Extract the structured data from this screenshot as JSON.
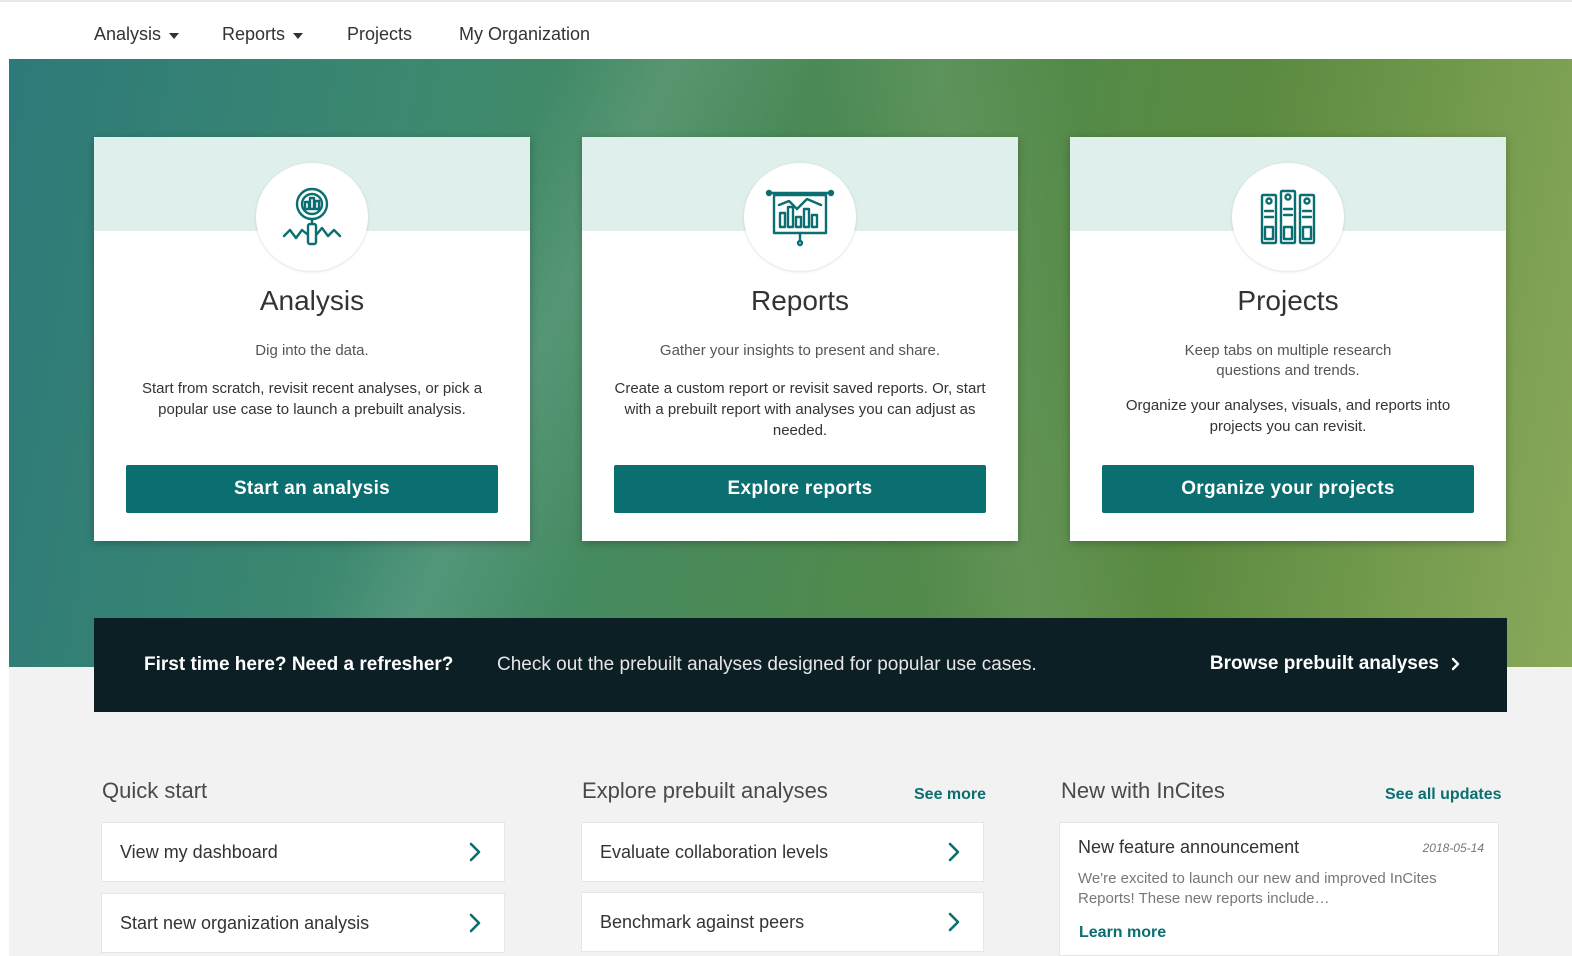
{
  "nav": {
    "items": [
      {
        "label": "Analysis",
        "dropdown": true
      },
      {
        "label": "Reports",
        "dropdown": true
      },
      {
        "label": "Projects",
        "dropdown": false
      },
      {
        "label": "My Organization",
        "dropdown": false
      }
    ]
  },
  "cards": [
    {
      "icon": "magnifier-chart-icon",
      "title": "Analysis",
      "subtitle": "Dig into the data.",
      "description": "Start from scratch, revisit recent analyses, or pick a popular use case to launch a prebuilt analysis.",
      "button": "Start an analysis"
    },
    {
      "icon": "presentation-board-icon",
      "title": "Reports",
      "subtitle": "Gather your insights to present and share.",
      "description": "Create a custom report or revisit saved reports. Or, start with a prebuilt report with analyses you can adjust as needed.",
      "button": "Explore reports"
    },
    {
      "icon": "binders-icon",
      "title": "Projects",
      "subtitle": "Keep tabs on multiple research questions and trends.",
      "description": "Organize your analyses, visuals, and reports into projects you can revisit.",
      "button": "Organize your projects"
    }
  ],
  "banner": {
    "heading": "First time here? Need a refresher?",
    "text": "Check out the prebuilt analyses designed for popular use cases.",
    "link": "Browse prebuilt analyses"
  },
  "quick_start": {
    "title": "Quick start",
    "items": [
      "View my dashboard",
      "Start new organization analysis"
    ]
  },
  "prebuilt": {
    "title": "Explore prebuilt analyses",
    "see_more": "See more",
    "items": [
      "Evaluate collaboration levels",
      "Benchmark against peers"
    ]
  },
  "news": {
    "title": "New with InCites",
    "see_all": "See all updates",
    "item": {
      "title": "New feature announcement",
      "date": "2018-05-14",
      "body": "We're excited to launch our new and improved InCites Reports! These new reports include…",
      "link": "Learn more"
    }
  },
  "colors": {
    "accent": "#0b6e70",
    "banner_bg": "#0c1f24",
    "card_top": "#deefec"
  }
}
